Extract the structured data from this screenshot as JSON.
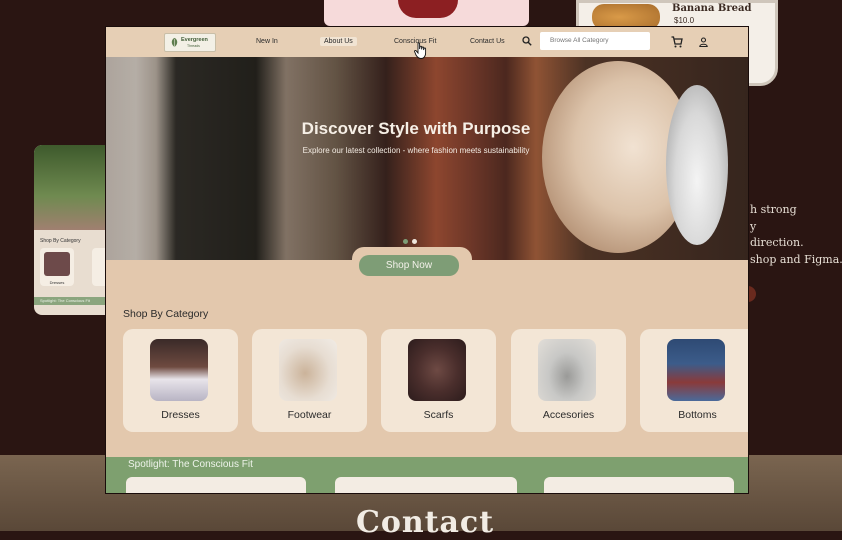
{
  "background": {
    "bread_card": {
      "name": "Banana Bread",
      "price": "$10.0"
    },
    "side_text": [
      "h strong",
      "y",
      "direction.",
      "shop and Figma."
    ],
    "contact_heading": "Contact",
    "side_card": {
      "category_label": "Shop By Category",
      "tile_label": "Dresses",
      "spotlight": "Spotlight: The Conscious Fit"
    }
  },
  "nav": {
    "logo_text": "Evergreen",
    "logo_sub": "Threads",
    "links": [
      "New In",
      "About Us",
      "Conscious Fit",
      "Contact Us"
    ],
    "search_placeholder": "Browse All Category"
  },
  "hero": {
    "title": "Discover Style with Purpose",
    "subtitle": "Explore our latest collection - where fashion meets sustainability",
    "button": "Shop Now"
  },
  "categories": {
    "title": "Shop By Category",
    "items": [
      "Dresses",
      "Footwear",
      "Scarfs",
      "Accesories",
      "Bottoms"
    ]
  },
  "spotlight": {
    "title": "Spotlight: The Conscious Fit"
  },
  "colors": {
    "accent_green": "#7e9d76",
    "nav_bg": "#e6cfb5",
    "card_bg": "#f3e6d6"
  }
}
